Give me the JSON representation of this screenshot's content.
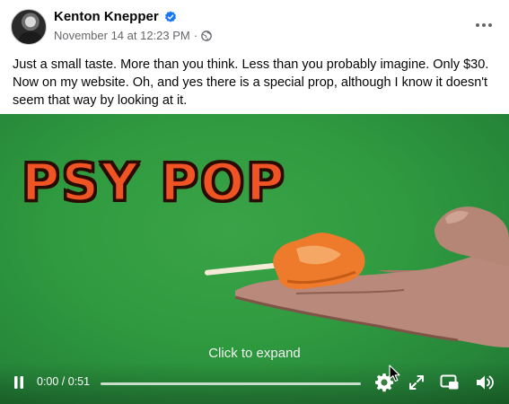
{
  "post": {
    "author": "Kenton Knepper",
    "date": "November 14 at 12:23 PM",
    "separator": "·",
    "text": "Just a small taste. More than you think. Less than you probably imagine. Only $30. Now on my website. Oh, and yes there is a special prop, although I know it doesn't seem that way by looking at it."
  },
  "video": {
    "title_overlay": "PSY POP",
    "click_to_expand": "Click to expand",
    "time": "0:00 / 0:51",
    "progress": 0.0
  },
  "colors": {
    "verified": "#1877f2",
    "green_screen": "#2f9a3f",
    "title_orange": "#f05424",
    "secondary_text": "#65676b"
  },
  "icons": {
    "verified": "verified-badge-icon",
    "audience": "globe-icon",
    "more": "more-options-icon",
    "pause": "pause-icon",
    "settings": "gear-icon",
    "expand": "expand-icon",
    "pip": "picture-in-picture-icon",
    "volume": "volume-icon"
  }
}
